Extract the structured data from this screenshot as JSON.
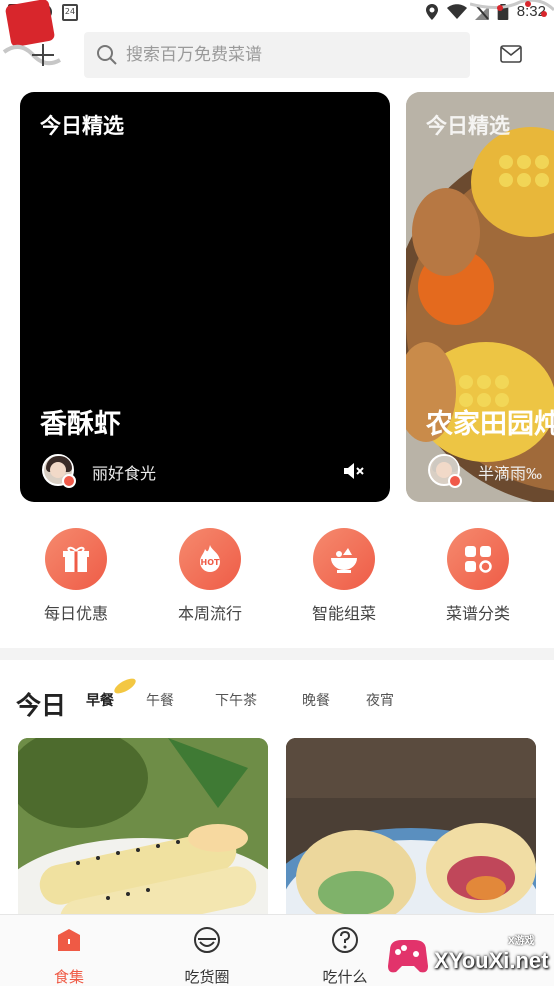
{
  "status_bar": {
    "time": "8:32",
    "calendar_day": "24"
  },
  "search": {
    "placeholder": "搜索百万免费菜谱"
  },
  "featured": [
    {
      "tag": "今日精选",
      "title": "香酥虾",
      "author": "丽好食光",
      "background": "#000000"
    },
    {
      "tag": "今日精选",
      "title": "农家田园炖",
      "author": "半滴雨‰"
    }
  ],
  "quick_actions": [
    {
      "label": "每日优惠",
      "icon": "gift-icon"
    },
    {
      "label": "本周流行",
      "icon": "hot-fire-icon"
    },
    {
      "label": "智能组菜",
      "icon": "food-bowl-icon"
    },
    {
      "label": "菜谱分类",
      "icon": "category-grid-icon"
    }
  ],
  "today": {
    "title": "今日",
    "tabs": [
      "早餐",
      "午餐",
      "下午茶",
      "晚餐",
      "夜宵"
    ],
    "active_tab": "早餐"
  },
  "bottom_nav": [
    {
      "label": "食集",
      "icon": "home-icon",
      "active": true
    },
    {
      "label": "吃货圈",
      "icon": "smile-icon",
      "active": false
    },
    {
      "label": "吃什么",
      "icon": "question-icon",
      "active": false
    }
  ],
  "watermark": {
    "text": "XYouXi.net",
    "small": "X游戏"
  },
  "colors": {
    "accent": "#ef5a45",
    "gradient_start": "#f58a6e",
    "gradient_end": "#ef5c47"
  }
}
